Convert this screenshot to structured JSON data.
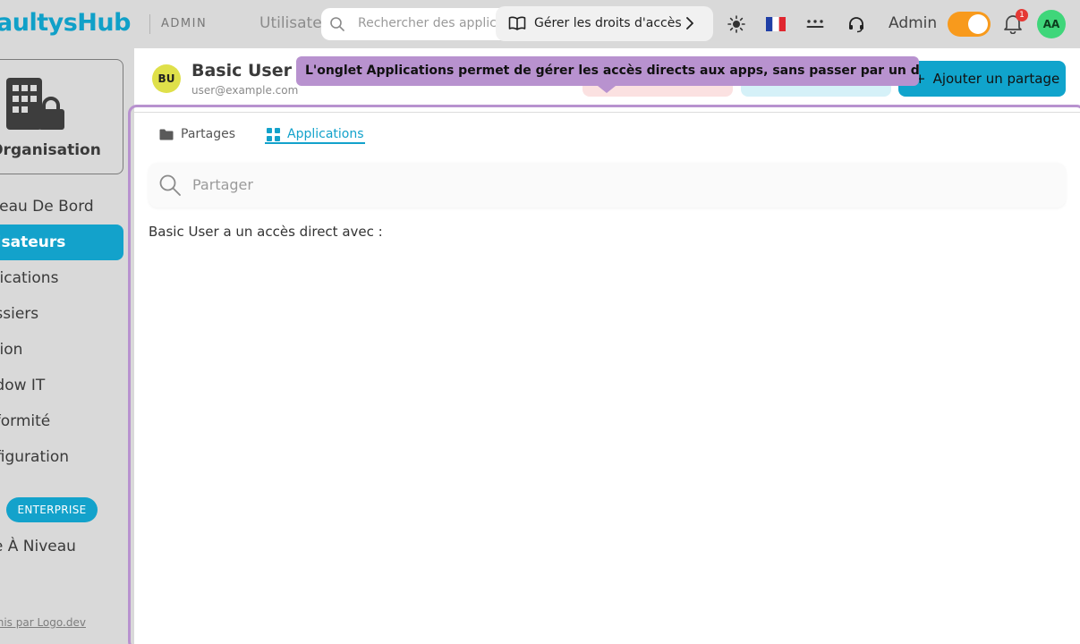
{
  "topbar": {
    "brand": "aultysHub",
    "admin_tag": "ADMIN",
    "nav_ghost": "Utilisateu",
    "search_placeholder": "Rechercher des applic",
    "tour_label": "Gérer les droits d'accès",
    "language_flag": "🇫🇷",
    "admin_name": "Admin",
    "notification_count": "1",
    "avatar_initials": "AA",
    "toggle_on": true,
    "toggle_color": "#f89a1c"
  },
  "sidebar": {
    "org_name": "nOrganisation",
    "items": [
      {
        "label": "oleau De Bord",
        "active": false
      },
      {
        "label": "ilisateurs",
        "active": true
      },
      {
        "label": "plications",
        "active": false
      },
      {
        "label": "ossiers",
        "active": false
      },
      {
        "label": "stion",
        "active": false
      },
      {
        "label": "adow IT",
        "active": false
      },
      {
        "label": "nformité",
        "active": false
      },
      {
        "label": "nfiguration",
        "active": false
      }
    ],
    "enterprise_badge": "ENTERPRISE",
    "upgrade_label": "se À Niveau",
    "footer_link": "rnis par Logo.dev"
  },
  "user": {
    "initials": "BU",
    "name": "Basic User",
    "email": "user@example.com"
  },
  "tooltip": {
    "text": "L'onglet Applications permet de gérer les accès directs aux apps, sans passer par un dossier",
    "color": "#b892cf"
  },
  "actions": {
    "add_share_label": "Ajouter un partage",
    "add_share_icon": "+"
  },
  "tabs": [
    {
      "label": "Partages",
      "icon": "folder-icon",
      "active": false
    },
    {
      "label": "Applications",
      "icon": "grid-icon",
      "active": true
    }
  ],
  "share_search": {
    "placeholder": "Partager"
  },
  "direct_access_text": "Basic User a un accès direct avec :",
  "colors": {
    "accent": "#13a2cb"
  }
}
